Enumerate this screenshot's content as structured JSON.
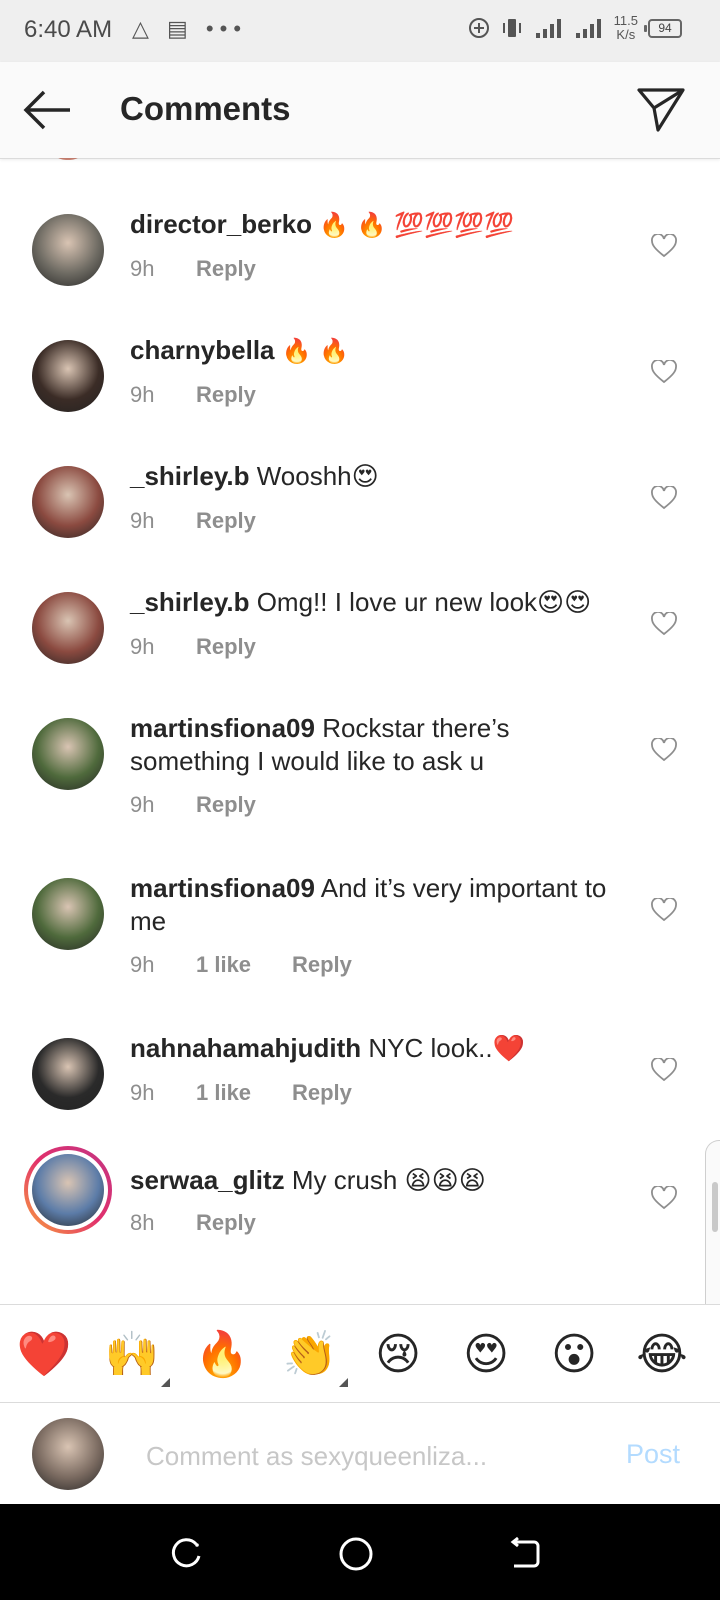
{
  "status_bar": {
    "time": "6:40 AM",
    "left_icons": "△ ▤ •••",
    "net_speed_value": "11.5",
    "net_speed_unit": "K/s",
    "battery": "94"
  },
  "header": {
    "title": "Comments",
    "back_icon": "arrow-left-icon",
    "share_icon": "paper-plane-icon"
  },
  "comments": [
    {
      "username": "director_berko",
      "text": "🔥 🔥 💯💯💯💯",
      "time": "9h",
      "likes": "",
      "reply": "Reply",
      "avatar_color": "#6d6a62"
    },
    {
      "username": "charnybella",
      "text": "🔥 🔥",
      "time": "9h",
      "likes": "",
      "reply": "Reply",
      "avatar_color": "#3b2c26"
    },
    {
      "username": "_shirley.b",
      "text": "Wooshh😍",
      "time": "9h",
      "likes": "",
      "reply": "Reply",
      "avatar_color": "#8b4a40"
    },
    {
      "username": "_shirley.b",
      "text": "Omg!! I love ur new look😍😍",
      "time": "9h",
      "likes": "",
      "reply": "Reply",
      "avatar_color": "#8b4a40"
    },
    {
      "username": "martinsfiona09",
      "text": "Rockstar there’s something I would like to ask u",
      "time": "9h",
      "likes": "",
      "reply": "Reply",
      "avatar_color": "#4f6a3c"
    },
    {
      "username": "martinsfiona09",
      "text": "And it’s very important to me",
      "time": "9h",
      "likes": "1 like",
      "reply": "Reply",
      "avatar_color": "#4f6a3c"
    },
    {
      "username": "nahnahamahjudith",
      "text": "NYC look..❤️",
      "time": "9h",
      "likes": "1 like",
      "reply": "Reply",
      "avatar_color": "#2a2a2a"
    },
    {
      "username": "serwaa_glitz",
      "text": "My crush 😫😫😫",
      "time": "8h",
      "likes": "",
      "reply": "Reply",
      "avatar_color": "#5c7ca8"
    }
  ],
  "reactions": [
    "❤️",
    "🙌",
    "🔥",
    "👏",
    "😢",
    "😍",
    "😮",
    "😂"
  ],
  "composer": {
    "placeholder": "Comment as sexyqueenliza...",
    "post_label": "Post",
    "avatar_color": "#7a6a60"
  },
  "colors": {
    "accent_post_disabled": "#b3dbff",
    "secondary_text": "#8e8e8e",
    "primary_text": "#262626"
  }
}
